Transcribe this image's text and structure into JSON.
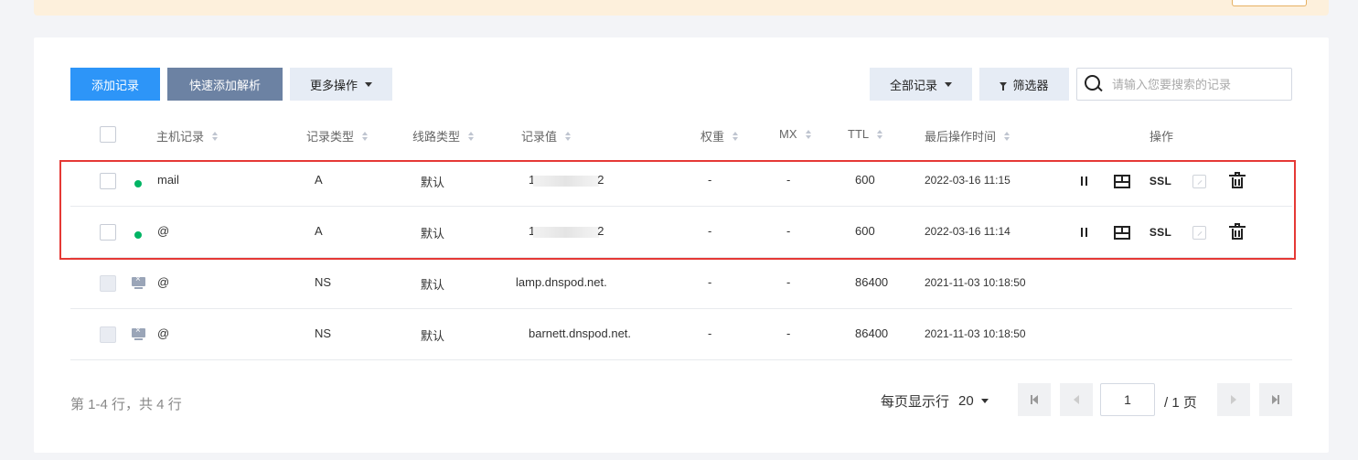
{
  "toolbar": {
    "add_record": "添加记录",
    "quick_add": "快速添加解析",
    "more_actions": "更多操作",
    "all_records": "全部记录",
    "filter": "筛选器",
    "search_placeholder": "请输入您要搜索的记录"
  },
  "table": {
    "headers": {
      "host": "主机记录",
      "type": "记录类型",
      "line": "线路类型",
      "value": "记录值",
      "weight": "权重",
      "mx": "MX",
      "ttl": "TTL",
      "updated": "最后操作时间",
      "actions": "操作"
    },
    "rows": [
      {
        "host": "mail",
        "type": "A",
        "line": "默认",
        "value_prefix": "1",
        "value_suffix": "2",
        "weight": "-",
        "mx": "-",
        "ttl": "600",
        "updated": "2022-03-16 11:15",
        "pause": "⏸",
        "ssl": "SSL"
      },
      {
        "host": "@",
        "type": "A",
        "line": "默认",
        "value_prefix": "1",
        "value_suffix": "2",
        "weight": "-",
        "mx": "-",
        "ttl": "600",
        "updated": "2022-03-16 11:14",
        "pause": "⏸",
        "ssl": "SSL"
      },
      {
        "host": "@",
        "type": "NS",
        "line": "默认",
        "value": "lamp.dnspod.net.",
        "weight": "-",
        "mx": "-",
        "ttl": "86400",
        "updated": "2021-11-03 10:18:50"
      },
      {
        "host": "@",
        "type": "NS",
        "line": "默认",
        "value": "barnett.dnspod.net.",
        "weight": "-",
        "mx": "-",
        "ttl": "86400",
        "updated": "2021-11-03 10:18:50"
      }
    ]
  },
  "pagination": {
    "summary": "第 1-4 行，共 4 行",
    "page_size_label": "每页显示行",
    "page_size": "20",
    "current_page": "1",
    "total_pages": "/ 1 页"
  },
  "colors": {
    "primary": "#2d95f8",
    "secondary": "#6c82a3",
    "status_active": "#00b464",
    "highlight": "#e53935"
  }
}
